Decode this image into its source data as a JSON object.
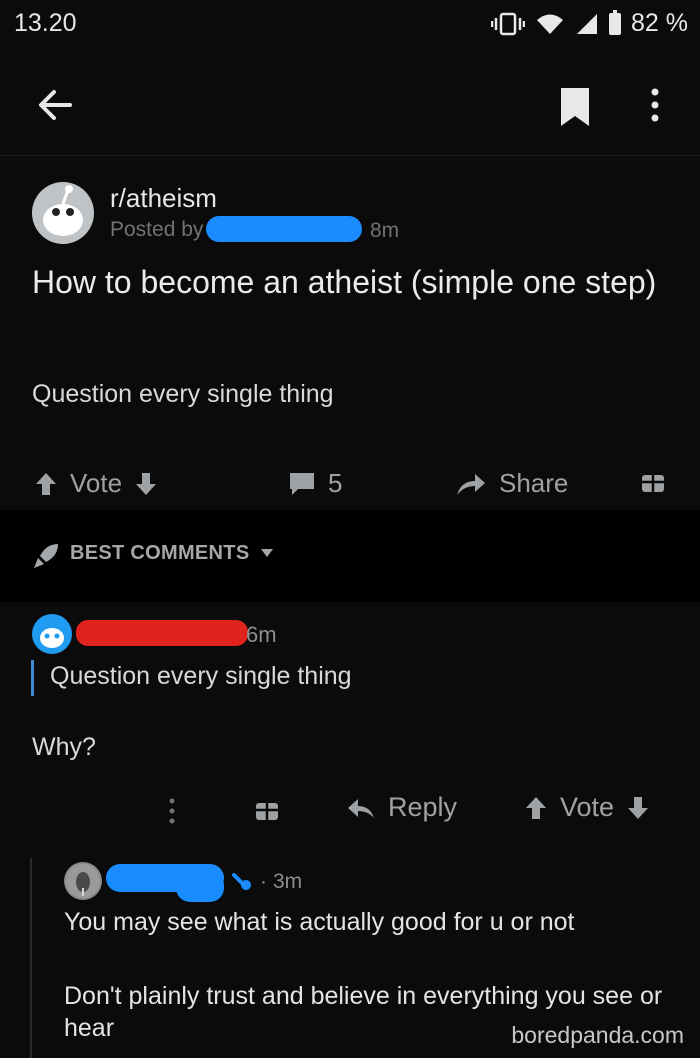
{
  "status": {
    "time": "13.20",
    "battery": "82 %",
    "icons": [
      "vibrate-icon",
      "wifi-icon",
      "signal-icon",
      "battery-icon"
    ]
  },
  "toolbar": {
    "back_icon": "arrow-left-icon",
    "bookmark_icon": "bookmark-icon",
    "more_icon": "more-vertical-icon"
  },
  "post": {
    "subreddit": "r/atheism",
    "posted_by": "Posted by",
    "time": "8m",
    "title": "How to become an atheist (simple one step)",
    "body": "Question every single thing",
    "actions": {
      "vote": "Vote",
      "comments": "5",
      "share": "Share"
    }
  },
  "sort": {
    "label": "BEST COMMENTS"
  },
  "comment1": {
    "time": "6m",
    "quote": "Question every single thing",
    "body": "Why?",
    "reply_label": "Reply",
    "vote_label": "Vote"
  },
  "reply1": {
    "time": "3m",
    "text1": "You may see what is actually good for u or not",
    "text2": "Don't plainly trust and believe in everything you see or hear"
  },
  "watermark": "boredpanda.com",
  "colors": {
    "background": "#0b0b0b",
    "redaction_blue": "#1a8cff",
    "redaction_red": "#e0231c",
    "quote_bar": "#3b8bd8"
  }
}
